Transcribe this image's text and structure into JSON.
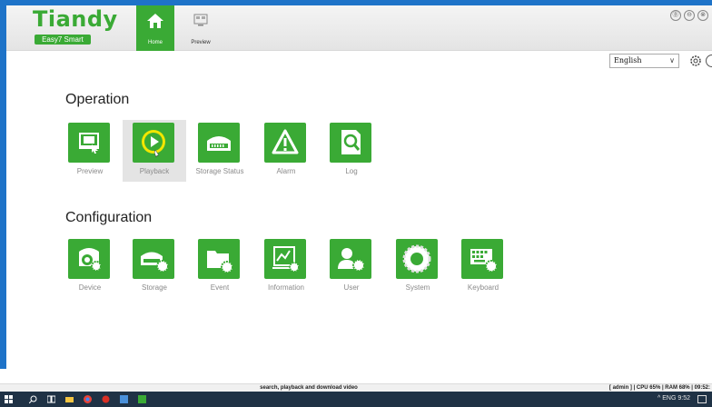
{
  "app": {
    "brand": "Tiandy",
    "brand_sub": "Easy7 Smart"
  },
  "nav": {
    "home_label": "Home",
    "preview_label": "Preview"
  },
  "window_controls": [
    "Ⓑ",
    "⊖",
    "⊗"
  ],
  "language": {
    "selected": "English"
  },
  "operation": {
    "title": "Operation",
    "items": [
      {
        "label": "Preview",
        "icon": "preview-icon"
      },
      {
        "label": "Playback",
        "icon": "playback-icon"
      },
      {
        "label": "Storage Status",
        "icon": "storage-status-icon"
      },
      {
        "label": "Alarm",
        "icon": "alarm-icon"
      },
      {
        "label": "Log",
        "icon": "log-icon"
      }
    ]
  },
  "configuration": {
    "title": "Configuration",
    "items": [
      {
        "label": "Device",
        "icon": "device-icon"
      },
      {
        "label": "Storage",
        "icon": "storage-icon"
      },
      {
        "label": "Event",
        "icon": "event-icon"
      },
      {
        "label": "Information",
        "icon": "information-icon"
      },
      {
        "label": "User",
        "icon": "user-icon"
      },
      {
        "label": "System",
        "icon": "system-icon"
      },
      {
        "label": "Keyboard",
        "icon": "keyboard-icon"
      }
    ]
  },
  "status": {
    "hint": "search, playback and download video",
    "system": "[ admin ] | CPU  65% | RAM  68% | 09:52:"
  },
  "taskbar": {
    "tray_text": "^  ENG   9:52"
  },
  "colors": {
    "brand_green": "#3aaa35",
    "frame_blue": "#1e73c8",
    "taskbar": "#1f3245"
  }
}
